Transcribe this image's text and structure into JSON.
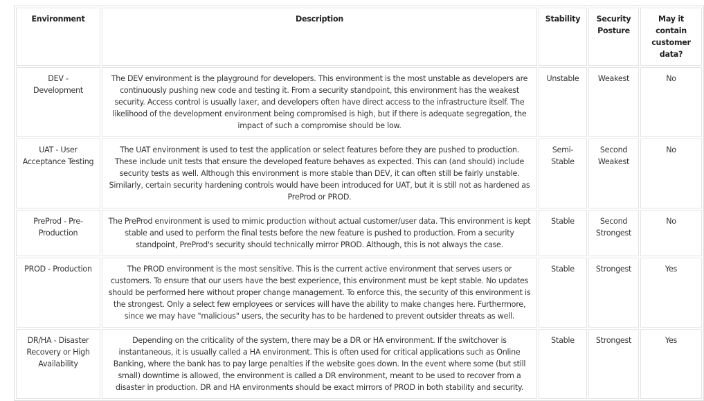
{
  "table": {
    "headers": [
      "Environment",
      "Description",
      "Stability",
      "Security Posture",
      "May it contain customer data?"
    ],
    "rows": [
      {
        "environment": "DEV - Development",
        "description": "The DEV environment is the playground for developers. This environment is the most unstable as developers are continuously pushing new code and testing it. From a security standpoint, this environment has the weakest security. Access control is usually laxer, and developers often have direct access to the infrastructure itself. The likelihood of the development environment being compromised is high, but if there is adequate segregation, the impact of such a compromise should be low.",
        "stability": "Unstable",
        "security_posture": "Weakest",
        "customer_data": "No"
      },
      {
        "environment": "UAT - User Acceptance Testing",
        "description": "The UAT environment is used to test the application or select features before they are pushed to production. These include unit tests that ensure the developed feature behaves as expected. This can (and should) include security tests as well. Although this environment is more stable than DEV, it can often still be fairly unstable. Similarly, certain security hardening controls would have been introduced for UAT, but it is still not as hardened as PreProd or PROD.",
        "stability": "Semi-Stable",
        "security_posture": "Second Weakest",
        "customer_data": "No"
      },
      {
        "environment": "PreProd - Pre-Production",
        "description": "The PreProd environment is used to mimic production without actual customer/user data. This environment is kept stable and used to perform the final tests before the new feature is pushed to production. From a security standpoint, PreProd's security should technically mirror PROD. Although, this is not always the case.",
        "stability": "Stable",
        "security_posture": "Second Strongest",
        "customer_data": "No"
      },
      {
        "environment": "PROD - Production",
        "description": "The PROD environment is the most sensitive. This is the current active environment that serves users or customers. To ensure that our users have the best experience, this environment must be kept stable. No updates should be performed here without proper change management. To enforce this, the security of this environment is the strongest. Only a select few employees or services will have the ability to make changes here. Furthermore, since we may have \"malicious\" users, the security has to be hardened to prevent outsider threats as well.",
        "stability": "Stable",
        "security_posture": "Strongest",
        "customer_data": "Yes"
      },
      {
        "environment": "DR/HA - Disaster Recovery or High Availability",
        "description": "Depending on the criticality of the system, there may be a DR or HA environment. If the switchover is instantaneous, it is usually called a HA environment. This is often used for critical applications such as Online Banking, where the bank has to pay large penalties if the website goes down. In the event where some (but still small) downtime is allowed, the environment is called a DR environment, meant to be used to recover from a disaster in production. DR and HA environments should be exact mirrors of PROD in both stability and security.",
        "stability": "Stable",
        "security_posture": "Strongest",
        "customer_data": "Yes"
      }
    ]
  }
}
